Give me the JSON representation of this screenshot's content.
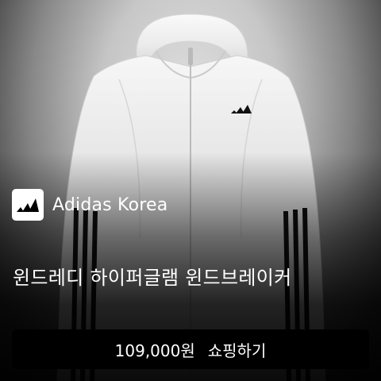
{
  "brand": {
    "name": "Adidas Korea",
    "logo_icon": "adidas-three-bars-icon"
  },
  "product": {
    "title": "윈드레디 하이퍼글램 윈드브레이커",
    "image_icon": "white-hooded-windbreaker-jacket"
  },
  "cta": {
    "price": "109,000원",
    "label": "쇼핑하기"
  },
  "colors": {
    "cta_background": "#000000",
    "text": "#ffffff",
    "logo_background": "#ffffff",
    "jacket": "#f2f2f2",
    "stripes": "#111111"
  }
}
